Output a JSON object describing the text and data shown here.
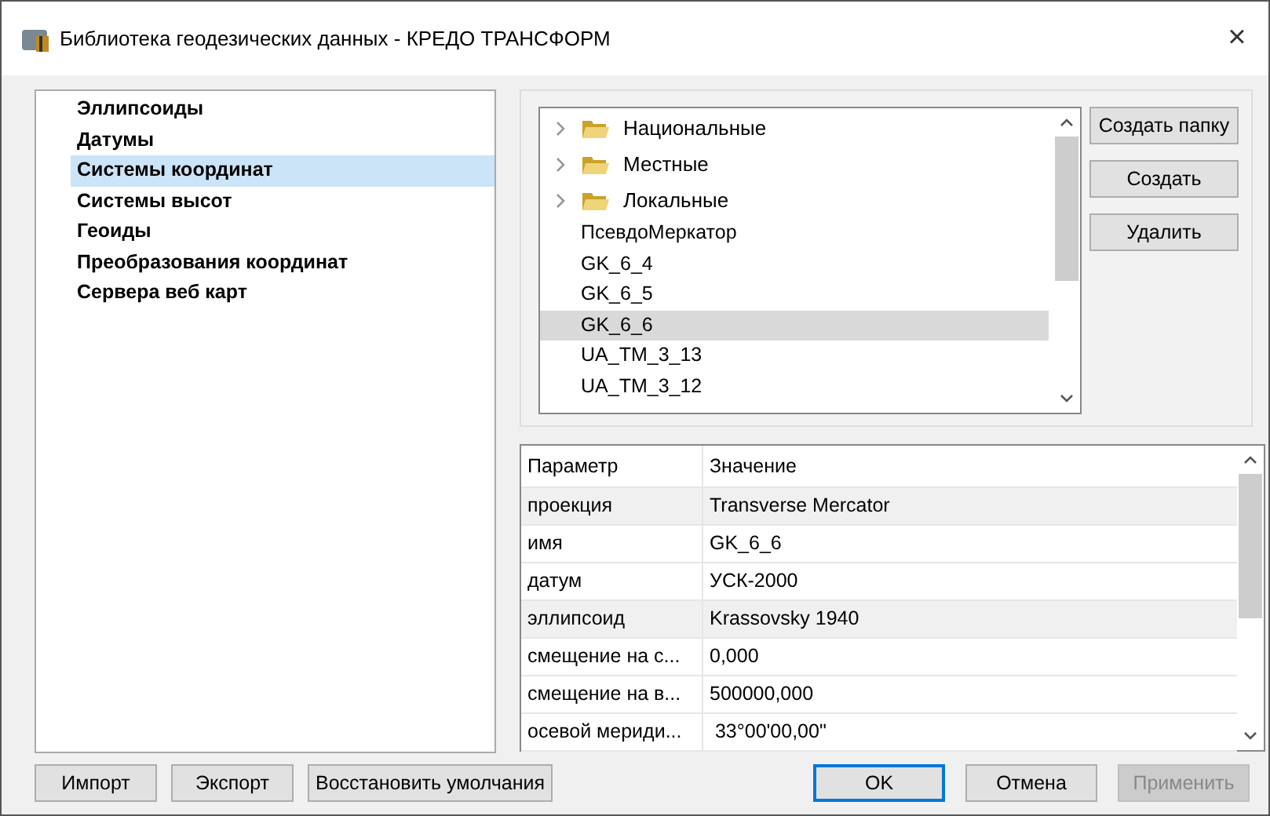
{
  "window": {
    "title": "Библиотека геодезических данных - КРЕДО ТРАНСФОРМ",
    "close": "×"
  },
  "sidebar": {
    "items": [
      {
        "label": "Эллипсоиды",
        "selected": false
      },
      {
        "label": "Датумы",
        "selected": false
      },
      {
        "label": "Системы координат",
        "selected": true
      },
      {
        "label": "Системы высот",
        "selected": false
      },
      {
        "label": "Геоиды",
        "selected": false
      },
      {
        "label": "Преобразования координат",
        "selected": false
      },
      {
        "label": "Сервера веб карт",
        "selected": false
      }
    ]
  },
  "tree": {
    "items": [
      {
        "kind": "folder",
        "label": "Национальные",
        "selected": false
      },
      {
        "kind": "folder",
        "label": "Местные",
        "selected": false
      },
      {
        "kind": "folder",
        "label": "Локальные",
        "selected": false
      },
      {
        "kind": "item",
        "label": "ПсевдоМеркатор",
        "selected": false
      },
      {
        "kind": "item",
        "label": "GK_6_4",
        "selected": false
      },
      {
        "kind": "item",
        "label": "GK_6_5",
        "selected": false
      },
      {
        "kind": "item",
        "label": "GK_6_6",
        "selected": true
      },
      {
        "kind": "item",
        "label": "UA_TM_3_13",
        "selected": false
      },
      {
        "kind": "item",
        "label": "UA_TM_3_12",
        "selected": false
      }
    ]
  },
  "tree_buttons": [
    "Создать папку",
    "Создать",
    "Удалить"
  ],
  "properties": {
    "columns": [
      "Параметр",
      "Значение"
    ],
    "rows": [
      {
        "name": "проекция",
        "value": "Transverse Mercator",
        "shaded": true
      },
      {
        "name": "имя",
        "value": "GK_6_6",
        "shaded": false
      },
      {
        "name": "датум",
        "value": "УСК-2000",
        "shaded": false
      },
      {
        "name": "эллипсоид",
        "value": "Krassovsky 1940",
        "shaded": true
      },
      {
        "name": "смещение на с...",
        "value": "0,000",
        "shaded": false
      },
      {
        "name": "смещение на в...",
        "value": "500000,000",
        "shaded": false
      },
      {
        "name": "осевой мериди...",
        "value": " 33°00'00,00\"",
        "shaded": false
      }
    ]
  },
  "left_buttons": [
    "Импорт",
    "Экспорт",
    "Восстановить умолчания"
  ],
  "right_buttons": [
    {
      "label": "OK",
      "default": true,
      "disabled": false
    },
    {
      "label": "Отмена",
      "default": false,
      "disabled": false
    },
    {
      "label": "Применить",
      "default": false,
      "disabled": true
    }
  ]
}
